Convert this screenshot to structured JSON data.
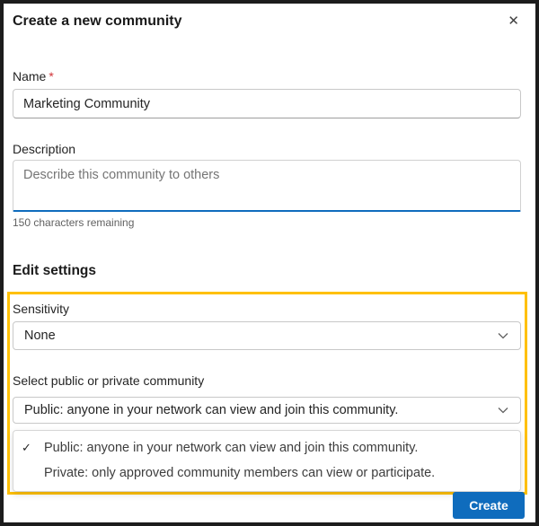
{
  "dialog": {
    "title": "Create a new community"
  },
  "icons": {
    "close": "✕"
  },
  "name_field": {
    "label": "Name",
    "required_mark": "*",
    "value": "Marketing Community"
  },
  "description_field": {
    "label": "Description",
    "placeholder": "Describe this community to others",
    "helper": "150 characters remaining"
  },
  "settings": {
    "heading": "Edit settings",
    "highlight_color": "#ffc000",
    "sensitivity": {
      "label": "Sensitivity",
      "value": "None"
    },
    "privacy": {
      "label": "Select public or private community",
      "value": "Public: anyone in your network can view and join this community.",
      "options": [
        {
          "check": "✓",
          "label": "Public: anyone in your network can view and join this community."
        },
        {
          "check": "",
          "label": "Private: only approved community members can view or participate."
        }
      ]
    }
  },
  "footer": {
    "create_label": "Create"
  },
  "colors": {
    "accent_blue": "#0f6cbd",
    "highlight_yellow": "#ffc000",
    "required_red": "#d13438"
  }
}
